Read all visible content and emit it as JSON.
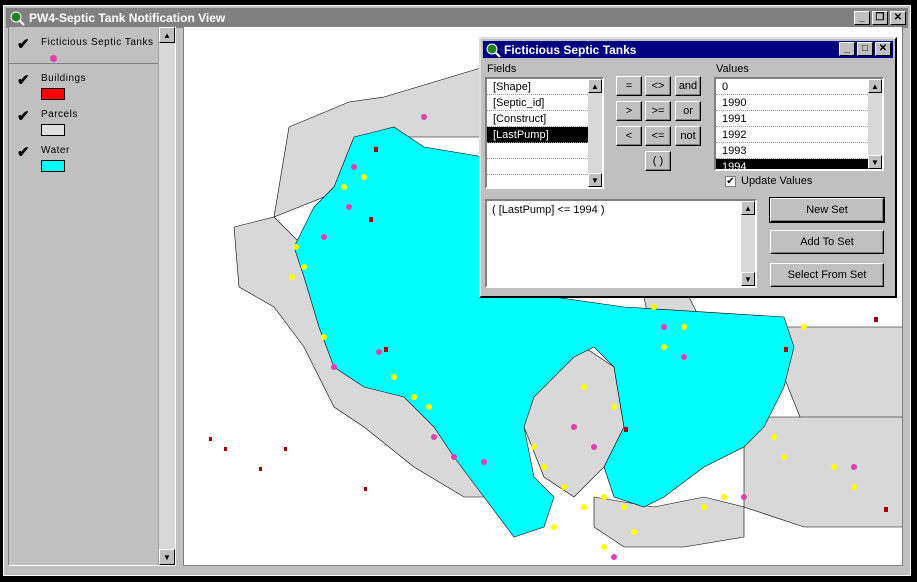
{
  "window": {
    "title": "PW4-Septic Tank Notification View"
  },
  "toc": {
    "layers": [
      {
        "name": "Ficticious Septic Tanks",
        "visible": true,
        "symbol": "point",
        "color": "#e040b0"
      },
      {
        "name": "Buildings",
        "visible": true,
        "symbol": "fill",
        "color": "#ff0000"
      },
      {
        "name": "Parcels",
        "visible": true,
        "symbol": "fill",
        "color": "#e0e0e0"
      },
      {
        "name": "Water",
        "visible": true,
        "symbol": "fill",
        "color": "#00ffff"
      }
    ]
  },
  "query": {
    "title": "Ficticious Septic Tanks",
    "fields_label": "Fields",
    "fields": [
      "[Shape]",
      "[Septic_id]",
      "[Construct]",
      "[LastPump]",
      "",
      ""
    ],
    "selected_field": "[LastPump]",
    "values_label": "Values",
    "values": [
      "0",
      "1990",
      "1991",
      "1992",
      "1993",
      "1994"
    ],
    "selected_value": "1994",
    "operators": [
      "=",
      "<>",
      "and",
      ">",
      ">=",
      "or",
      "<",
      "<=",
      "not",
      "( )"
    ],
    "update_values_label": "Update Values",
    "update_values_checked": true,
    "expression": "( [LastPump] <= 1994 )",
    "buttons": {
      "new_set": "New Set",
      "add_to_set": "Add To Set",
      "select_from_set": "Select From Set"
    }
  },
  "colors": {
    "water": "#00ffff",
    "parcel": "#d8d8d8",
    "tank": "#e040b0",
    "selected": "#ffff00",
    "building": "#a00000"
  }
}
